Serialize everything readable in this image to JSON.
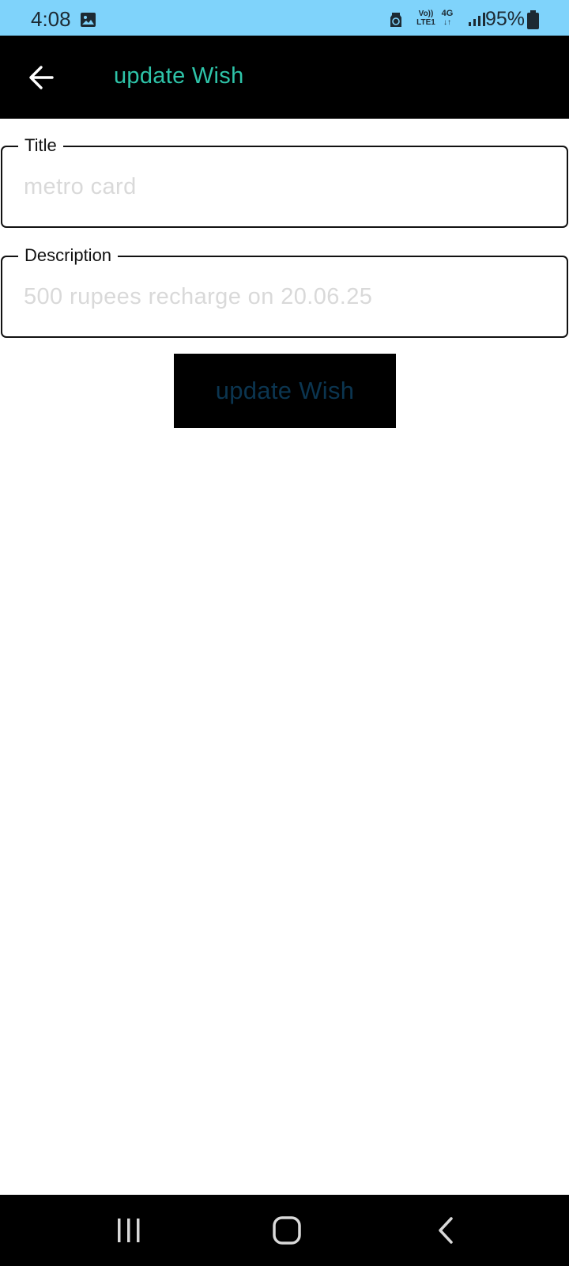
{
  "status_bar": {
    "time": "4:08",
    "battery_percent": "95%",
    "volte_label_top": "Vo))",
    "volte_label_bottom": "LTE1",
    "network_label": "4G",
    "background_color": "#7fd3fb"
  },
  "app_bar": {
    "title": "update Wish",
    "title_color": "#2ec4a9",
    "back_icon": "arrow-left-icon"
  },
  "form": {
    "title_field": {
      "label": "Title",
      "value": "metro card"
    },
    "description_field": {
      "label": "Description",
      "value": "500 rupees recharge on 20.06.25"
    },
    "submit_button": {
      "label": "update Wish",
      "text_color": "#0b3550"
    }
  },
  "nav_bar": {
    "recents_icon": "recents-icon",
    "home_icon": "home-icon",
    "back_icon": "back-chevron-icon"
  }
}
